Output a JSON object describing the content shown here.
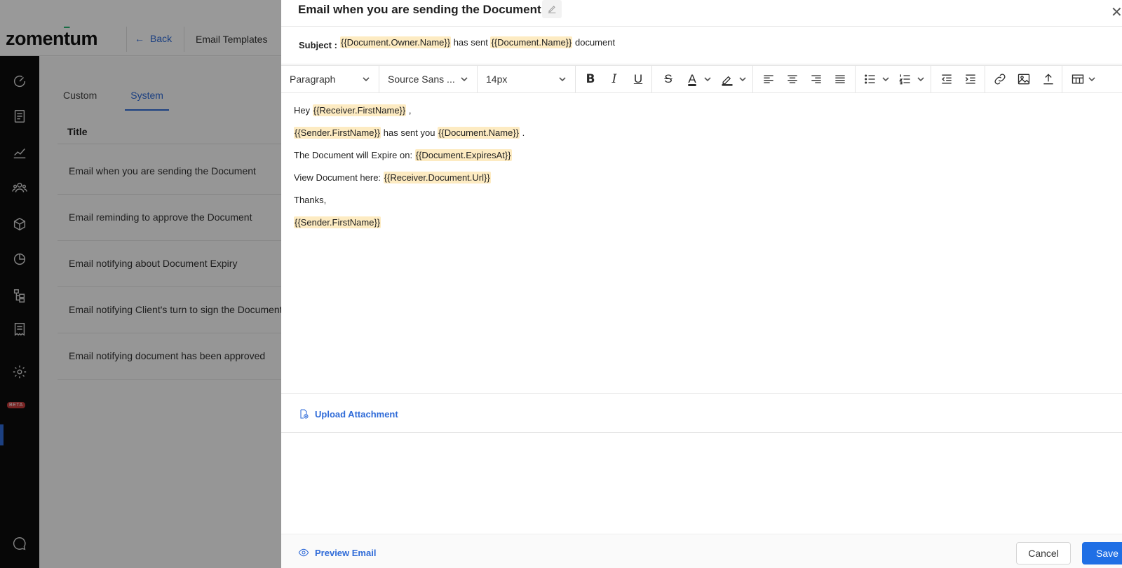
{
  "app": {
    "logo_text": "zomentum",
    "back_label": "Back",
    "section_title": "Email Templates"
  },
  "sidebar": {
    "icons": [
      "dashboard-icon",
      "documents-icon",
      "analytics-icon",
      "contacts-icon",
      "products-icon",
      "reports-icon",
      "workflow-icon",
      "billing-icon",
      "settings-icon",
      "chat-icon"
    ],
    "beta_label": "BETA"
  },
  "templates": {
    "tabs": [
      {
        "label": "Custom",
        "active": false
      },
      {
        "label": "System",
        "active": true
      }
    ],
    "column_title": "Title",
    "rows": [
      "Email when you are sending the Document",
      "Email reminding to approve the Document",
      "Email notifying about Document Expiry",
      "Email notifying Client's turn to sign the Document",
      "Email notifying document has been approved"
    ]
  },
  "drawer": {
    "title": "Email when you are sending the Document",
    "subject_label": "Subject :",
    "subject": {
      "tag1": "{{Document.Owner.Name}}",
      "mid": " has sent ",
      "tag2": "{{Document.Name}}",
      "end": " document"
    },
    "toolbar": {
      "block_format": "Paragraph",
      "font_family": "Source Sans ...",
      "font_size": "14px"
    },
    "body": {
      "line1_prefix": "Hey ",
      "line1_tag": "{{Receiver.FirstName}}",
      "line1_suffix": " ,",
      "line2_tag1": "{{Sender.FirstName}}",
      "line2_mid": " has sent you ",
      "line2_tag2": "{{Document.Name}}",
      "line2_suffix": " .",
      "line3_prefix": "The Document will Expire on: ",
      "line3_tag": "{{Document.ExpiresAt}}",
      "line4_prefix": "View Document here: ",
      "line4_tag": "{{Receiver.Document.Url}}",
      "line5": "Thanks,",
      "line6_tag": "{{Sender.FirstName}}"
    },
    "upload_label": "Upload Attachment",
    "preview_label": "Preview Email",
    "cancel_label": "Cancel",
    "save_label": "Save"
  },
  "colors": {
    "accent": "#1f6fe5",
    "link": "#2f6bd8",
    "tag_highlight": "#fdebc2",
    "sidebar_bg": "#0c0c0c"
  }
}
